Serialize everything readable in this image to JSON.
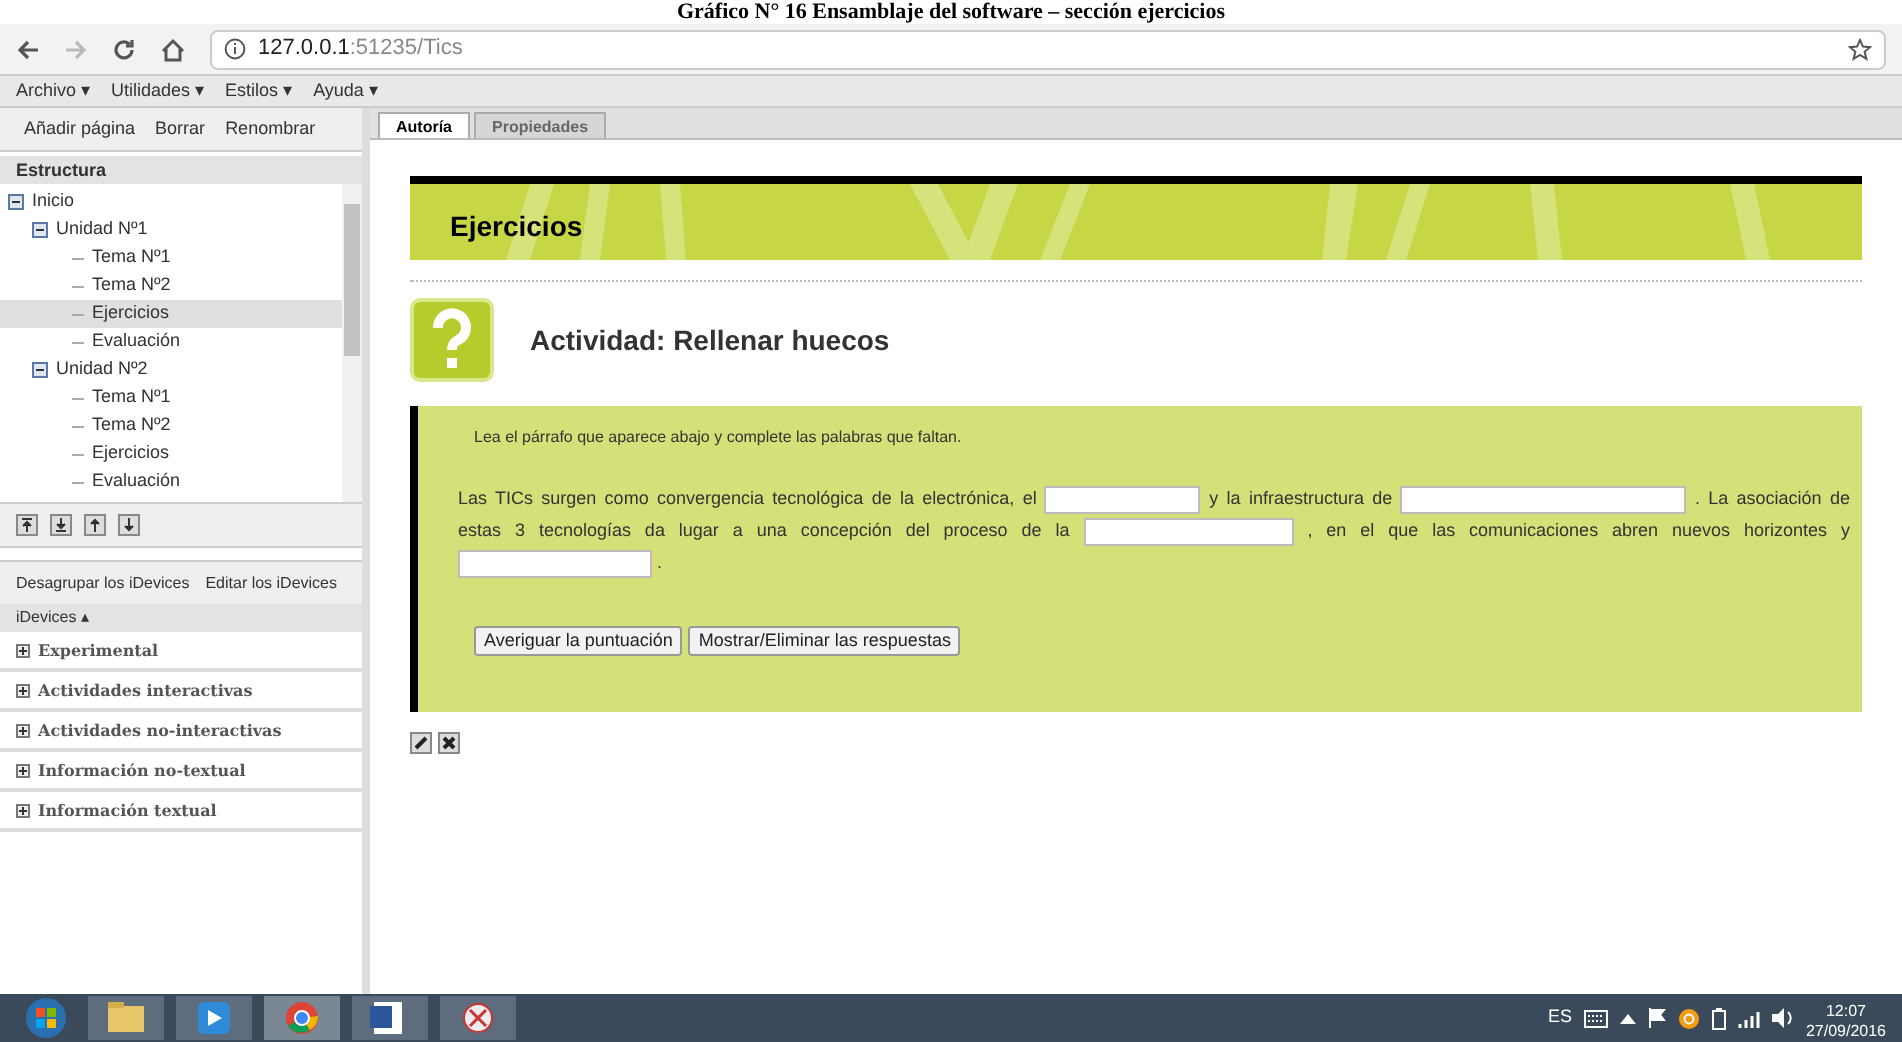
{
  "caption": "Gráfico N° 16 Ensamblaje del software – sección ejercicios",
  "browser": {
    "url_host": "127.0.0.1",
    "url_rest": ":51235/Tics"
  },
  "menu": [
    "Archivo ▾",
    "Utilidades ▾",
    "Estilos ▾",
    "Ayuda ▾"
  ],
  "page_actions": [
    "Añadir página",
    "Borrar",
    "Renombrar"
  ],
  "structure": {
    "title": "Estructura",
    "tree": [
      {
        "label": "Inicio",
        "selected": false,
        "children": [
          {
            "label": "Unidad Nº1",
            "selected": false,
            "children": [
              {
                "label": "Tema Nº1",
                "selected": false
              },
              {
                "label": "Tema Nº2",
                "selected": false
              },
              {
                "label": "Ejercicios",
                "selected": true
              },
              {
                "label": "Evaluación",
                "selected": false
              }
            ]
          },
          {
            "label": "Unidad Nº2",
            "selected": false,
            "children": [
              {
                "label": "Tema Nº1",
                "selected": false
              },
              {
                "label": "Tema Nº2",
                "selected": false
              },
              {
                "label": "Ejercicios",
                "selected": false
              },
              {
                "label": "Evaluación",
                "selected": false
              }
            ]
          }
        ]
      }
    ]
  },
  "idevice_actions": [
    "Desagrupar los iDevices",
    "Editar los iDevices"
  ],
  "idevices_header": "iDevices ▴",
  "idevice_groups": [
    "Experimental",
    "Actividades interactivas",
    "Actividades no-interactivas",
    "Información no-textual",
    "Información textual"
  ],
  "tabs": [
    {
      "label": "Autoría",
      "selected": true
    },
    {
      "label": "Propiedades",
      "selected": false
    }
  ],
  "page_title": "Ejercicios",
  "activity_title": "Actividad: Rellenar huecos",
  "instructions": "Lea el párrafo que aparece abajo y complete las palabras que faltan.",
  "paragraph": [
    {
      "kind": "text",
      "text": "Las TICs surgen como convergencia tecnológica de la electrónica, el"
    },
    {
      "kind": "blank"
    },
    {
      "kind": "text",
      "text": "y la infraestructura de"
    },
    {
      "kind": "blank"
    },
    {
      "kind": "text",
      "text": ". La asociación de"
    },
    {
      "kind": "text",
      "text": "estas 3 tecnologías da lugar a una concepción del proceso de la"
    },
    {
      "kind": "blank"
    },
    {
      "kind": "text",
      "text": ", en el que las comunicaciones abren nuevos horizontes y"
    },
    {
      "kind": "blank"
    },
    {
      "kind": "text",
      "text": "."
    }
  ],
  "buttons": [
    "Averiguar la puntuación",
    "Mostrar/Eliminar las respuestas"
  ],
  "taskbar": {
    "language": "ES",
    "time": "12:07",
    "date": "27/09/2016"
  }
}
